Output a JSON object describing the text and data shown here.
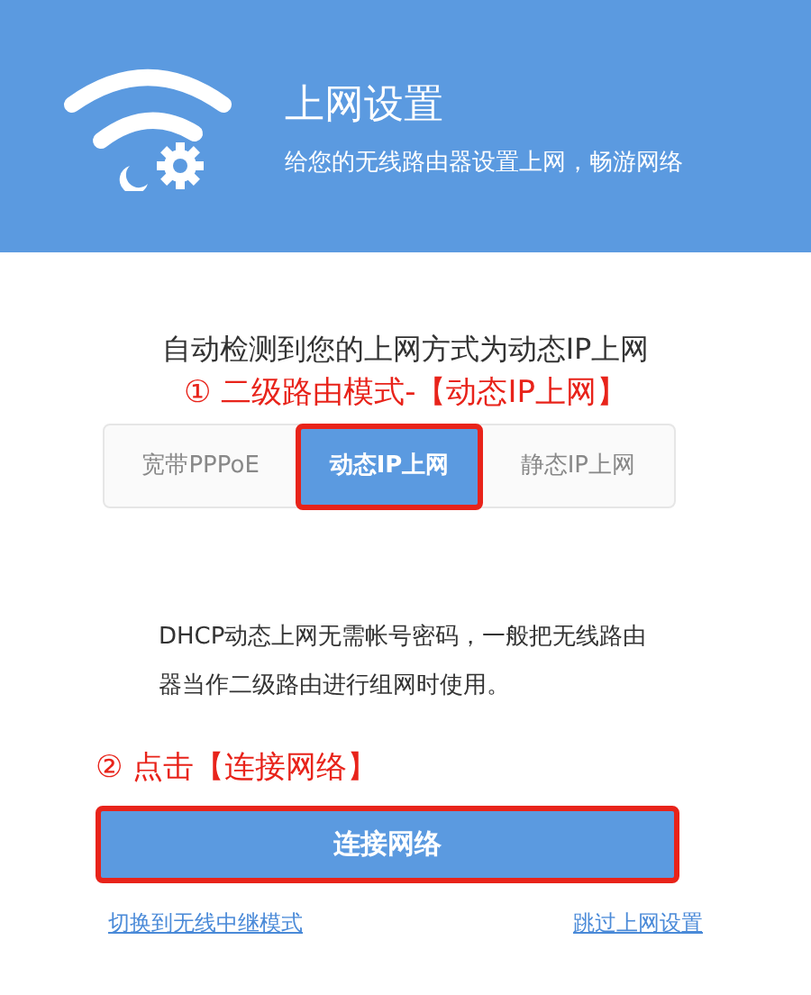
{
  "header": {
    "title": "上网设置",
    "subtitle": "给您的无线路由器设置上网，畅游网络"
  },
  "detected_text": "自动检测到您的上网方式为动态IP上网",
  "annotations": [
    "① 二级路由模式-【动态IP上网】",
    "② 点击【连接网络】"
  ],
  "tabs": [
    {
      "label": "宽带PPPoE",
      "selected": false,
      "marked": false
    },
    {
      "label": "动态IP上网",
      "selected": true,
      "marked": true
    },
    {
      "label": "静态IP上网",
      "selected": false,
      "marked": false
    }
  ],
  "description": "DHCP动态上网无需帐号密码，一般把无线路由器当作二级路由进行组网时使用。",
  "connect_button": {
    "label": "连接网络",
    "marked": true
  },
  "links": [
    "切换到无线中继模式",
    "跳过上网设置"
  ]
}
